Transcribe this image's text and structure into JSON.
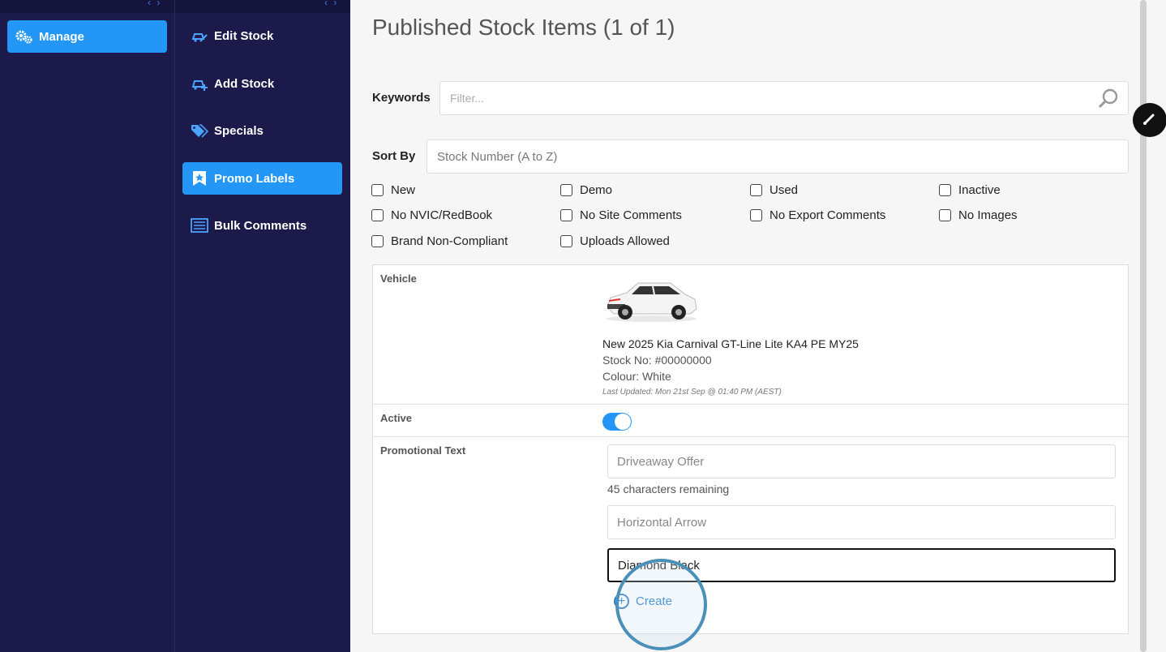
{
  "sidebar_primary": {
    "items": [
      {
        "label": "Manage",
        "icon": "gears-icon",
        "active": true
      }
    ]
  },
  "sidebar_secondary": {
    "items": [
      {
        "label": "Edit Stock",
        "icon": "car-edit-icon"
      },
      {
        "label": "Add Stock",
        "icon": "car-add-icon"
      },
      {
        "label": "Specials",
        "icon": "tags-icon"
      },
      {
        "label": "Promo Labels",
        "icon": "star-badge-icon",
        "active": true
      },
      {
        "label": "Bulk Comments",
        "icon": "list-icon"
      }
    ]
  },
  "main": {
    "title": "Published Stock Items (1 of 1)",
    "keywords": {
      "label": "Keywords",
      "placeholder": "Filter..."
    },
    "sort": {
      "label": "Sort By",
      "value": "Stock Number (A to Z)"
    },
    "filters": [
      "New",
      "Demo",
      "Used",
      "Inactive",
      "No NVIC/RedBook",
      "No Site Comments",
      "No Export Comments",
      "No Images",
      "Brand Non-Compliant",
      "Uploads Allowed"
    ]
  },
  "vehicle": {
    "label": "Vehicle",
    "title": "New 2025 Kia Carnival GT-Line Lite KA4 PE MY25",
    "stock_no": "Stock No: #00000000",
    "colour": "Colour: White",
    "last_updated": "Last Updated: Mon 21st Sep @ 01:40 PM (AEST)"
  },
  "active": {
    "label": "Active",
    "value": true
  },
  "promo": {
    "label": "Promotional Text",
    "text": "Driveaway Offer",
    "chars_remaining": "45 characters remaining",
    "style": "Horizontal Arrow",
    "colour": "Diamond Black",
    "create_label": "Create"
  },
  "colors": {
    "accent": "#2496f5",
    "sidebar": "#1b1a4a"
  }
}
